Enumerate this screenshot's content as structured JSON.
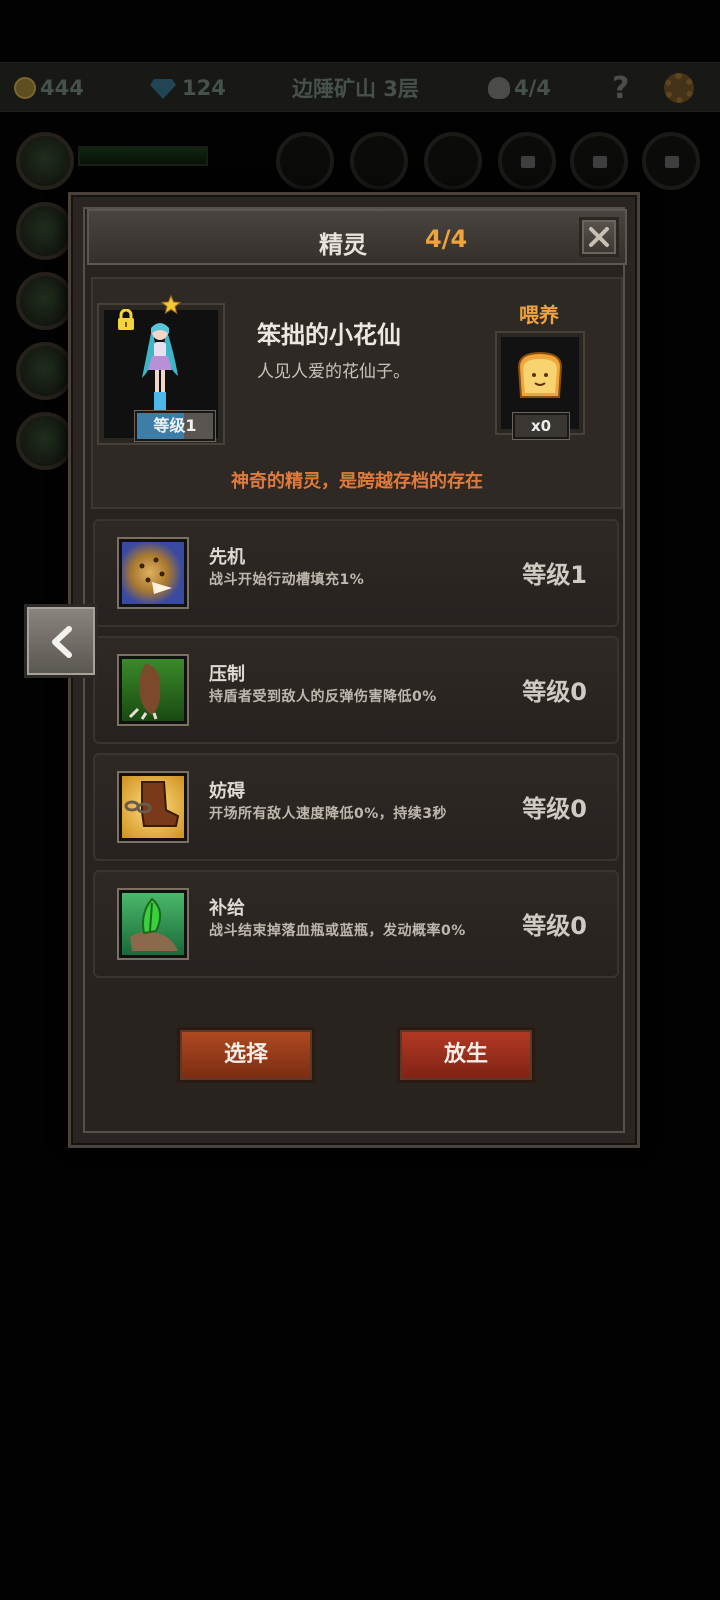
{
  "topbar": {
    "gold": "444",
    "gems": "124",
    "location": "边陲矿山 3层",
    "kills": "4/4",
    "help": "?"
  },
  "dialog": {
    "title": "精灵",
    "count": "4/4",
    "close_icon": "close-icon"
  },
  "sprite": {
    "name": "笨拙的小花仙",
    "description": "人见人爱的花仙子。",
    "level": "等级1",
    "locked": true,
    "feed_label": "喂养",
    "food_count": "x0",
    "note": "神奇的精灵，是跨越存档的存在"
  },
  "skills": [
    {
      "name": "先机",
      "desc": "战斗开始行动槽填充1%",
      "level": "等级1",
      "icon": "leopard-icon"
    },
    {
      "name": "压制",
      "desc": "持盾者受到敌人的反弹伤害降低0%",
      "level": "等级0",
      "icon": "claw-icon"
    },
    {
      "name": "妨碍",
      "desc": "开场所有敌人速度降低0%，持续3秒",
      "level": "等级0",
      "icon": "shackle-icon"
    },
    {
      "name": "补给",
      "desc": "战斗结束掉落血瓶或蓝瓶，发动概率0%",
      "level": "等级0",
      "icon": "herb-icon"
    }
  ],
  "buttons": {
    "select": "选择",
    "release": "放生"
  },
  "colors": {
    "accent": "#f0a23c",
    "note": "#e07a3a",
    "button": "#a04020"
  }
}
